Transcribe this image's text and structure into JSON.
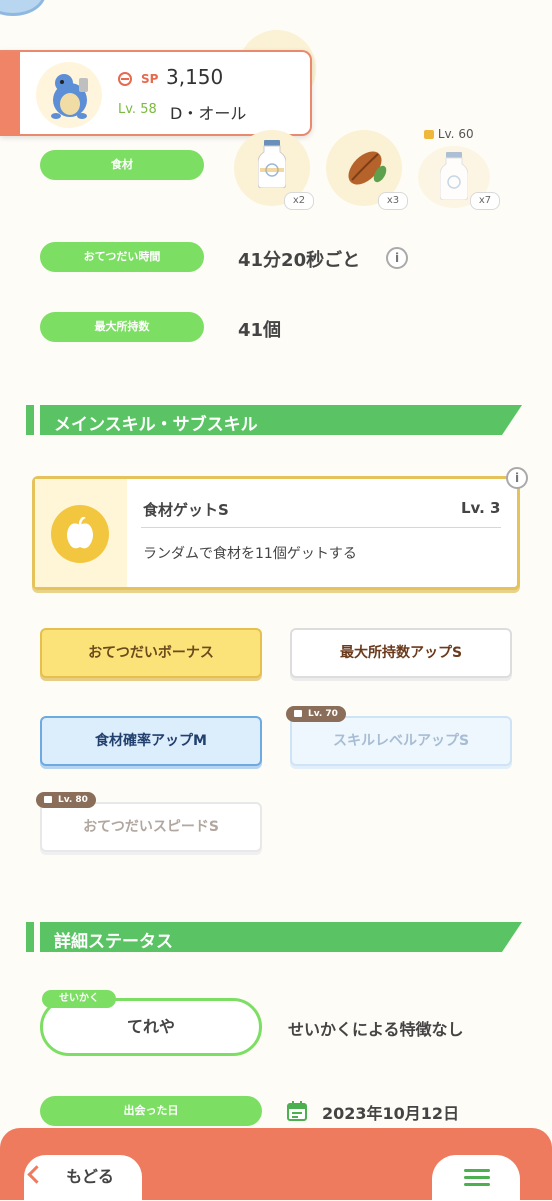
{
  "header": {
    "sp_label": "SP",
    "sp_value": "3,150",
    "level_label": "Lv. 58",
    "name": "D・オール"
  },
  "ingredients": {
    "label": "食材",
    "items": [
      {
        "icon": "milk-bottle-icon",
        "count": "x2",
        "locked": false
      },
      {
        "icon": "cacao-bean-icon",
        "count": "x3",
        "locked": false
      },
      {
        "icon": "milk-bottle-icon",
        "count": "x7",
        "locked": true,
        "lock_level": "Lv. 60"
      }
    ]
  },
  "help_time": {
    "label": "おてつだい時間",
    "value": "41分20秒ごと"
  },
  "max_carry": {
    "label": "最大所持数",
    "value": "41個"
  },
  "skills_section": {
    "title": "メインスキル・サブスキル"
  },
  "main_skill": {
    "name": "食材ゲットS",
    "level": "Lv. 3",
    "description": "ランダムで食材を11個ゲットする",
    "icon": "apple-icon"
  },
  "sub_skills": [
    {
      "label": "おてつだいボーナス",
      "style": "gold",
      "locked": false
    },
    {
      "label": "最大所持数アップS",
      "style": "white",
      "locked": false
    },
    {
      "label": "食材確率アップM",
      "style": "blue",
      "locked": false
    },
    {
      "label": "スキルレベルアップS",
      "style": "lightblue",
      "locked": true,
      "lock_level": "Lv. 70"
    },
    {
      "label": "おてつだいスピードS",
      "style": "grey",
      "locked": true,
      "lock_level": "Lv. 80"
    }
  ],
  "details_section": {
    "title": "詳細ステータス"
  },
  "nature": {
    "tag": "せいかく",
    "value": "てれや",
    "effect": "せいかくによる特徴なし"
  },
  "met_date": {
    "label": "出会った日",
    "value": "2023年10月12日"
  },
  "footer": {
    "back_label": "もどる"
  },
  "colors": {
    "accent_green": "#7dde64",
    "footer": "#ef7b5e",
    "section_green": "#5ac364"
  }
}
